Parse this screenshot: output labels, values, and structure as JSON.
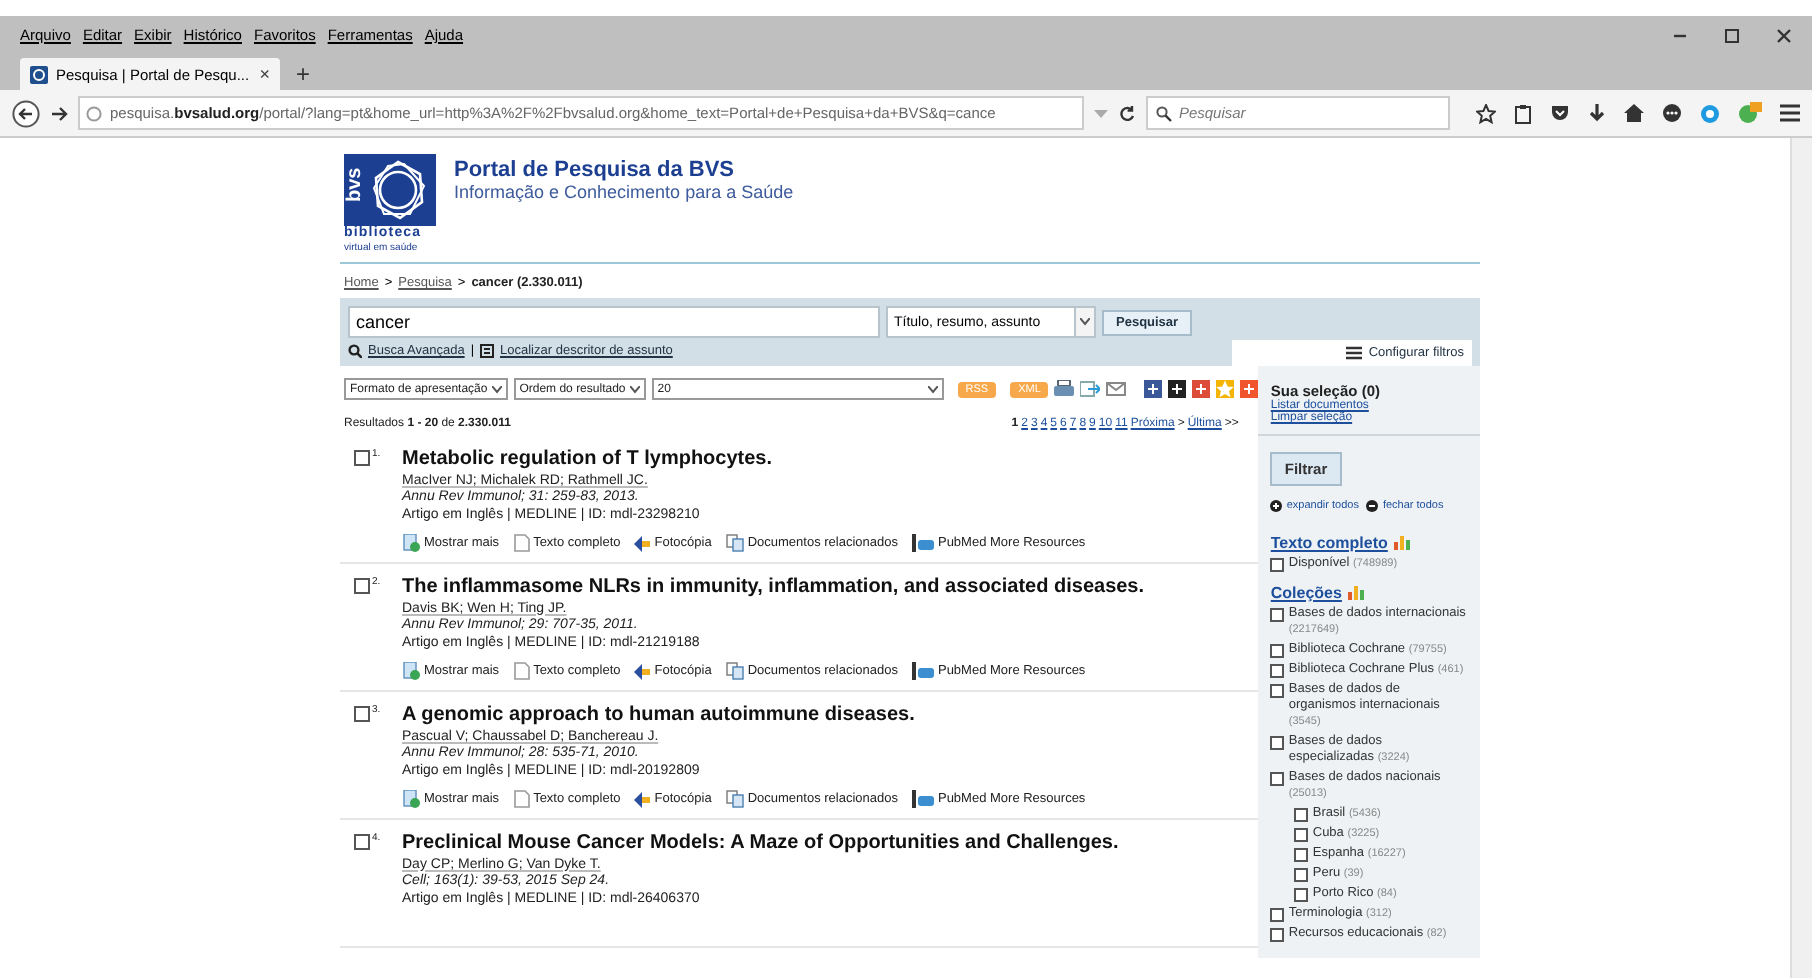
{
  "menu_bar": [
    "Arquivo",
    "Editar",
    "Exibir",
    "Histórico",
    "Favoritos",
    "Ferramentas",
    "Ajuda"
  ],
  "tab": {
    "title": "Pesquisa | Portal de Pesqu...",
    "close": "×",
    "new_tab": "+",
    "selected": true
  },
  "address_bar": {
    "url": "pesquisa.**bvsalud.org**/portal/?lang=pt&home_url=http%3A%2F%2Fbvsalud.org&home_text=Portal+de+Pesquisa+da+BVS&q=cance",
    "search_placeholder": "Pesquisar"
  },
  "header": {
    "logo_mark": "bvs",
    "logo_name": "biblioteca",
    "logo_tagline": "virtual em saúde",
    "title": "Portal de Pesquisa da BVS",
    "subtitle": "Informação e Conhecimento para a Saúde"
  },
  "breadcrumb": [
    {
      "label": "Home",
      "link": true
    },
    {
      "label": "Pesquisa",
      "link": true
    },
    {
      "label": "cancer (2.330.011)",
      "link": false
    }
  ],
  "breadcrumb_separator": ">",
  "search": {
    "value": "cancer",
    "field": "Título, resumo, assunto",
    "button": "Pesquisar",
    "advanced": "Busca Avançada",
    "separator": "|",
    "descriptor": "Localizar descritor de assunto",
    "config": "Configurar filtros"
  },
  "toolbar": {
    "selects": [
      "Formato de apresentação",
      "Ordem do resultado",
      "20"
    ],
    "feeds": [
      "RSS",
      "XML"
    ]
  },
  "summary": "Resultados **1 - 20** de **2.330.011**",
  "pagination": {
    "pages": [
      {
        "label": "1",
        "selected": true
      },
      {
        "label": "2",
        "selected": false
      },
      {
        "label": "3",
        "selected": false
      },
      {
        "label": "4",
        "selected": false
      },
      {
        "label": "5",
        "selected": false
      },
      {
        "label": "6",
        "selected": false
      },
      {
        "label": "7",
        "selected": false
      },
      {
        "label": "8",
        "selected": false
      },
      {
        "label": "9",
        "selected": false
      },
      {
        "label": "10",
        "selected": false
      },
      {
        "label": "11",
        "selected": false
      }
    ],
    "next": "Próxima",
    "next_arrow": ">",
    "last": "Última",
    "last_arrow": ">>"
  },
  "results": [
    {
      "number": "1.",
      "checked": false,
      "title": "Metabolic regulation of T lymphocytes.",
      "authors": "MacIver NJ; Michalek RD; Rathmell JC.",
      "journal": "Annu Rev Immunol; 31: 259-83, 2013.",
      "meta": "Artigo em Inglês | MEDLINE | ID: mdl-23298210",
      "actions": [
        {
          "kind": "more",
          "label": "Mostrar mais"
        },
        {
          "kind": "fulltext",
          "label": "Texto completo"
        },
        {
          "kind": "copy",
          "label": "Fotocópia"
        },
        {
          "kind": "related",
          "label": "Documentos relacionados"
        },
        {
          "kind": "pubmed",
          "label": "PubMed More Resources"
        }
      ]
    },
    {
      "number": "2.",
      "checked": false,
      "title": "The inflammasome NLRs in immunity, inflammation, and associated diseases.",
      "authors": "Davis BK; Wen H; Ting JP.",
      "journal": "Annu Rev Immunol; 29: 707-35, 2011.",
      "meta": "Artigo em Inglês | MEDLINE | ID: mdl-21219188",
      "actions": [
        {
          "kind": "more",
          "label": "Mostrar mais"
        },
        {
          "kind": "fulltext",
          "label": "Texto completo"
        },
        {
          "kind": "copy",
          "label": "Fotocópia"
        },
        {
          "kind": "related",
          "label": "Documentos relacionados"
        },
        {
          "kind": "pubmed",
          "label": "PubMed More Resources"
        }
      ]
    },
    {
      "number": "3.",
      "checked": false,
      "title": "A genomic approach to human autoimmune diseases.",
      "authors": "Pascual V; Chaussabel D; Banchereau J.",
      "journal": "Annu Rev Immunol; 28: 535-71, 2010.",
      "meta": "Artigo em Inglês | MEDLINE | ID: mdl-20192809",
      "actions": [
        {
          "kind": "more",
          "label": "Mostrar mais"
        },
        {
          "kind": "fulltext",
          "label": "Texto completo"
        },
        {
          "kind": "copy",
          "label": "Fotocópia"
        },
        {
          "kind": "related",
          "label": "Documentos relacionados"
        },
        {
          "kind": "pubmed",
          "label": "PubMed More Resources"
        }
      ]
    },
    {
      "number": "4.",
      "checked": false,
      "title": "Preclinical Mouse Cancer Models: A Maze of Opportunities and Challenges.",
      "authors": "Day CP; Merlino G; Van Dyke T.",
      "journal": "Cell; 163(1): 39-53, 2015 Sep 24.",
      "meta": "Artigo em Inglês | MEDLINE | ID: mdl-26406370"
    }
  ],
  "sidebar": {
    "selection": "Sua seleção (0)",
    "links": [
      "Listar documentos",
      "Limpar seleção"
    ],
    "filter_button": "Filtrar",
    "expand": "expandir todos",
    "collapse": "fechar todos",
    "facets": [
      {
        "title": "Texto completo",
        "items": [
          {
            "label": "Disponível",
            "count": "(748989)",
            "checked": false
          }
        ]
      },
      {
        "title": "Coleções",
        "items": [
          {
            "label": "Bases de dados internacionais",
            "count": "(2217649)",
            "checked": false
          },
          {
            "label": "Biblioteca Cochrane",
            "count": "(79755)",
            "checked": false
          },
          {
            "label": "Biblioteca Cochrane Plus",
            "count": "(461)",
            "checked": false
          },
          {
            "label": "Bases de dados de organismos internacionais",
            "count": "(3545)",
            "checked": false
          },
          {
            "label": "Bases de dados especializadas",
            "count": "(3224)",
            "checked": false
          },
          {
            "label": "Bases de dados nacionais",
            "count": "(25013)",
            "checked": false,
            "children": [
              {
                "label": "Brasil",
                "count": "(5436)",
                "checked": false
              },
              {
                "label": "Cuba",
                "count": "(3225)",
                "checked": false
              },
              {
                "label": "Espanha",
                "count": "(16227)",
                "checked": false
              },
              {
                "label": "Peru",
                "count": "(39)",
                "checked": false
              },
              {
                "label": "Porto Rico",
                "count": "(84)",
                "checked": false
              }
            ]
          },
          {
            "label": "Terminologia",
            "count": "(312)",
            "checked": false
          },
          {
            "label": "Recursos educacionais",
            "count": "(82)",
            "checked": false
          }
        ]
      }
    ]
  }
}
